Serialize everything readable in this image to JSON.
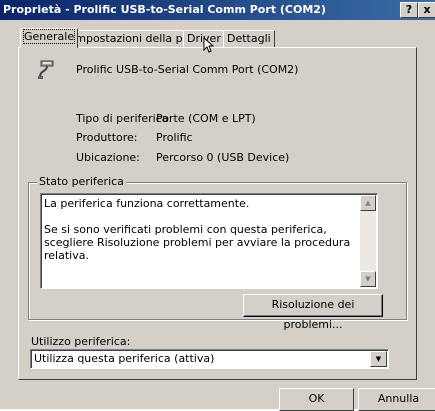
{
  "window": {
    "title": "Proprietà - Prolific USB-to-Serial Comm Port (COM2)",
    "help_btn": "?",
    "close_btn": "x"
  },
  "tabs": [
    {
      "label": "Generale",
      "active": true
    },
    {
      "label": "Impostazioni della porta",
      "active": false
    },
    {
      "label": "Driver",
      "active": false
    },
    {
      "label": "Dettagli",
      "active": false
    }
  ],
  "general": {
    "device_icon": "serial-port-icon",
    "device_name": "Prolific USB-to-Serial Comm Port (COM2)",
    "props": [
      {
        "label": "Tipo di periferica:",
        "value": "Porte (COM e LPT)"
      },
      {
        "label": "Produttore:",
        "value": "Prolific"
      },
      {
        "label": "Ubicazione:",
        "value": "Percorso 0 (USB Device)"
      }
    ],
    "status_group_title": "Stato periferica",
    "status_line1": "La periferica funziona correttamente.",
    "status_line2": "Se si sono verificati problemi con questa periferica, scegliere Risoluzione problemi per avviare la procedura relativa.",
    "troubleshoot_btn": "Risoluzione dei problemi...",
    "usage_label": "Utilizzo periferica:",
    "usage_selected": "Utilizza questa periferica (attiva)"
  },
  "footer": {
    "ok": "OK",
    "cancel": "Annulla"
  }
}
